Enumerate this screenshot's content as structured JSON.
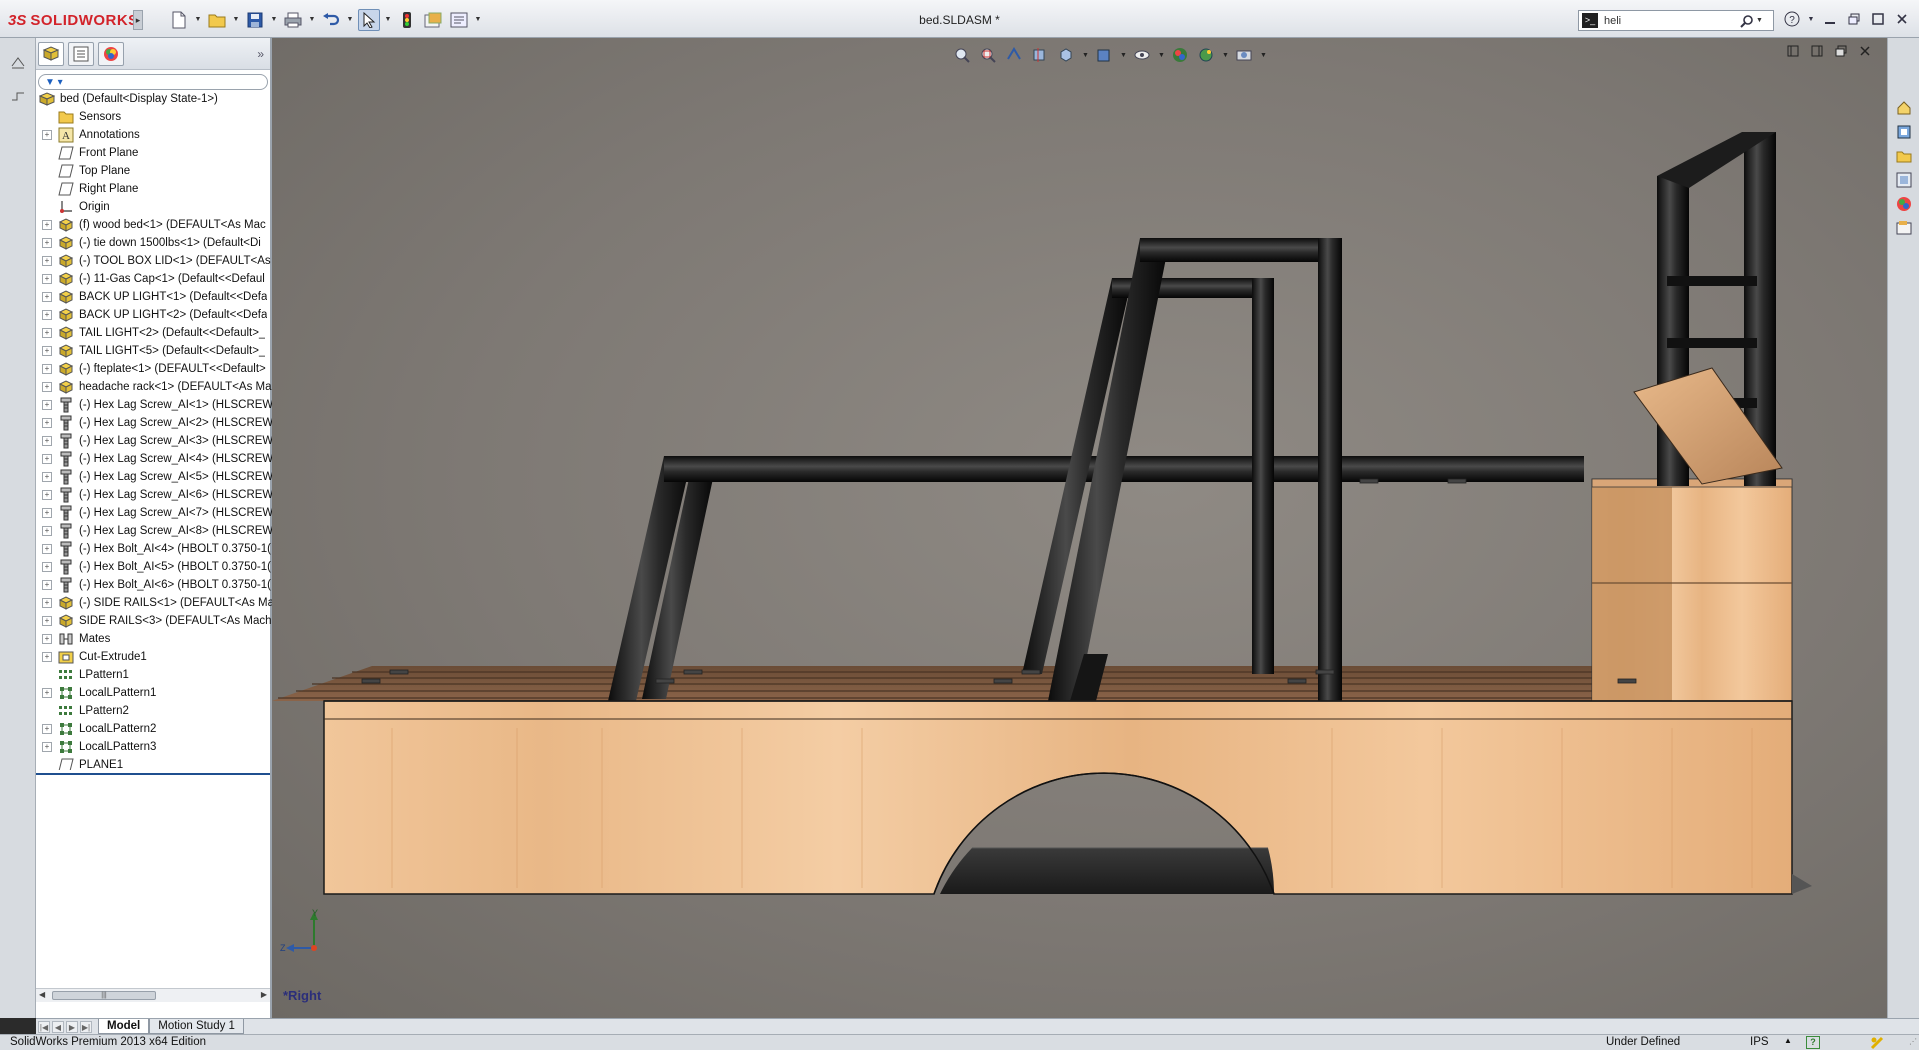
{
  "app": {
    "brand": "SOLIDWORKS",
    "brand_prefix": "3S",
    "document_title": "bed.SLDASM *",
    "accent_color": "#d2232a"
  },
  "search": {
    "value": "heli",
    "icons": [
      "command-search-icon",
      "magnifier-icon"
    ]
  },
  "toolbar": {
    "quick_access": [
      "new-document-icon",
      "open-icon",
      "save-icon",
      "print-icon",
      "undo-icon",
      "select-icon",
      "rebuild-icon",
      "file-properties-icon",
      "options-icon"
    ],
    "window_controls": [
      "help-icon",
      "minimize-icon",
      "maximize-icon",
      "restore-icon",
      "close-icon"
    ]
  },
  "feature_manager": {
    "tabs": [
      "featuremanager-tab",
      "propertymanager-tab",
      "display-manager-tab"
    ],
    "filter_icon": "filter-icon",
    "items": [
      {
        "label": "bed  (Default<Display State-1>)",
        "icon": "assembly",
        "expand": "none",
        "root": true
      },
      {
        "label": "Sensors",
        "icon": "folder",
        "expand": "none"
      },
      {
        "label": "Annotations",
        "icon": "annotation",
        "expand": "+"
      },
      {
        "label": "Front Plane",
        "icon": "plane",
        "expand": "none"
      },
      {
        "label": "Top Plane",
        "icon": "plane",
        "expand": "none"
      },
      {
        "label": "Right Plane",
        "icon": "plane",
        "expand": "none"
      },
      {
        "label": "Origin",
        "icon": "origin",
        "expand": "none"
      },
      {
        "label": "(f) wood bed<1> (DEFAULT<As Mac",
        "icon": "part",
        "expand": "+"
      },
      {
        "label": "(-) tie down 1500lbs<1> (Default<Di",
        "icon": "part",
        "expand": "+"
      },
      {
        "label": "(-) TOOL BOX LID<1> (DEFAULT<As",
        "icon": "part",
        "expand": "+"
      },
      {
        "label": "(-) 11-Gas Cap<1> (Default<<Defaul",
        "icon": "part",
        "expand": "+"
      },
      {
        "label": "BACK UP LIGHT<1> (Default<<Defa",
        "icon": "part",
        "expand": "+"
      },
      {
        "label": "BACK UP LIGHT<2> (Default<<Defa",
        "icon": "part",
        "expand": "+"
      },
      {
        "label": "TAIL LIGHT<2> (Default<<Default>_",
        "icon": "part",
        "expand": "+"
      },
      {
        "label": "TAIL LIGHT<5> (Default<<Default>_",
        "icon": "part",
        "expand": "+"
      },
      {
        "label": "(-) fteplate<1> (DEFAULT<<Default>",
        "icon": "part",
        "expand": "+"
      },
      {
        "label": "headache rack<1> (DEFAULT<As Ma",
        "icon": "part",
        "expand": "+"
      },
      {
        "label": "(-) Hex Lag Screw_AI<1> (HLSCREW",
        "icon": "screw",
        "expand": "+"
      },
      {
        "label": "(-) Hex Lag Screw_AI<2> (HLSCREW",
        "icon": "screw",
        "expand": "+"
      },
      {
        "label": "(-) Hex Lag Screw_AI<3> (HLSCREW",
        "icon": "screw",
        "expand": "+"
      },
      {
        "label": "(-) Hex Lag Screw_AI<4> (HLSCREW",
        "icon": "screw",
        "expand": "+"
      },
      {
        "label": "(-) Hex Lag Screw_AI<5> (HLSCREW",
        "icon": "screw",
        "expand": "+"
      },
      {
        "label": "(-) Hex Lag Screw_AI<6> (HLSCREW",
        "icon": "screw",
        "expand": "+"
      },
      {
        "label": "(-) Hex Lag Screw_AI<7> (HLSCREW",
        "icon": "screw",
        "expand": "+"
      },
      {
        "label": "(-) Hex Lag Screw_AI<8> (HLSCREW",
        "icon": "screw",
        "expand": "+"
      },
      {
        "label": "(-) Hex Bolt_AI<4> (HBOLT 0.3750-1(",
        "icon": "screw",
        "expand": "+"
      },
      {
        "label": "(-) Hex Bolt_AI<5> (HBOLT 0.3750-1(",
        "icon": "screw",
        "expand": "+"
      },
      {
        "label": "(-) Hex Bolt_AI<6> (HBOLT 0.3750-1(",
        "icon": "screw",
        "expand": "+"
      },
      {
        "label": "(-) SIDE RAILS<1> (DEFAULT<As Ma",
        "icon": "part",
        "expand": "+"
      },
      {
        "label": "SIDE RAILS<3> (DEFAULT<As Machi",
        "icon": "part",
        "expand": "+"
      },
      {
        "label": "Mates",
        "icon": "mates",
        "expand": "+"
      },
      {
        "label": "Cut-Extrude1",
        "icon": "cut",
        "expand": "+"
      },
      {
        "label": "LPattern1",
        "icon": "pattern",
        "expand": "none"
      },
      {
        "label": "LocalLPattern1",
        "icon": "local-pattern",
        "expand": "+"
      },
      {
        "label": "LPattern2",
        "icon": "pattern",
        "expand": "none"
      },
      {
        "label": "LocalLPattern2",
        "icon": "local-pattern",
        "expand": "+"
      },
      {
        "label": "LocalLPattern3",
        "icon": "local-pattern",
        "expand": "+"
      },
      {
        "label": "PLANE1",
        "icon": "plane",
        "expand": "none"
      }
    ]
  },
  "viewport": {
    "view_name": "*Right",
    "triad_labels": {
      "y": "Y",
      "z": "Z"
    },
    "background_color": "#807b76"
  },
  "bottom_tabs": [
    {
      "label": "Model",
      "selected": true
    },
    {
      "label": "Motion Study 1",
      "selected": false
    }
  ],
  "status": {
    "edition": "SolidWorks Premium 2013 x64 Edition",
    "state": "Under Defined",
    "units": "IPS",
    "help": "?"
  }
}
